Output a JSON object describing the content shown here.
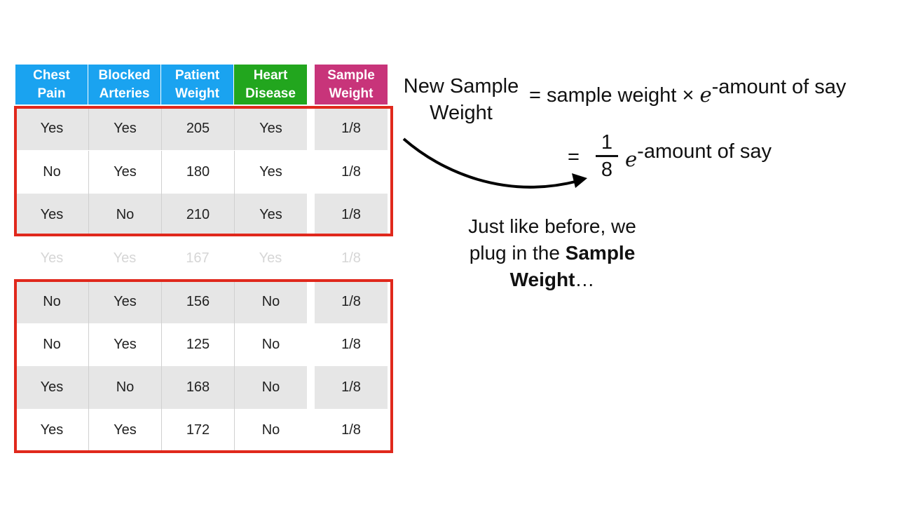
{
  "table": {
    "headers": [
      {
        "line1": "Chest",
        "line2": "Pain",
        "color": "#1aa3f0"
      },
      {
        "line1": "Blocked",
        "line2": "Arteries",
        "color": "#1aa3f0"
      },
      {
        "line1": "Patient",
        "line2": "Weight",
        "color": "#1aa3f0"
      },
      {
        "line1": "Heart",
        "line2": "Disease",
        "color": "#22a61e"
      },
      {
        "line1": "Sample",
        "line2": "Weight",
        "color": "#c8347a"
      }
    ],
    "rows": [
      [
        "Yes",
        "Yes",
        "205",
        "Yes",
        "1/8"
      ],
      [
        "No",
        "Yes",
        "180",
        "Yes",
        "1/8"
      ],
      [
        "Yes",
        "No",
        "210",
        "Yes",
        "1/8"
      ],
      [
        "Yes",
        "Yes",
        "167",
        "Yes",
        "1/8"
      ],
      [
        "No",
        "Yes",
        "156",
        "No",
        "1/8"
      ],
      [
        "No",
        "Yes",
        "125",
        "No",
        "1/8"
      ],
      [
        "Yes",
        "No",
        "168",
        "No",
        "1/8"
      ],
      [
        "Yes",
        "Yes",
        "172",
        "No",
        "1/8"
      ]
    ],
    "highlight_color": "#e0281c"
  },
  "equation": {
    "lhs_line1": "New Sample",
    "lhs_line2": "Weight",
    "eq1_rhs": "= sample weight",
    "times": "×",
    "e": "e",
    "exponent": "-amount of say",
    "eq2_equals": "=",
    "frac_num": "1",
    "frac_den": "8"
  },
  "caption": {
    "line1": "Just like before, we",
    "line2_prefix": "plug in the ",
    "line2_bold": "Sample",
    "line3_bold": "Weight",
    "line3_suffix": "…"
  }
}
